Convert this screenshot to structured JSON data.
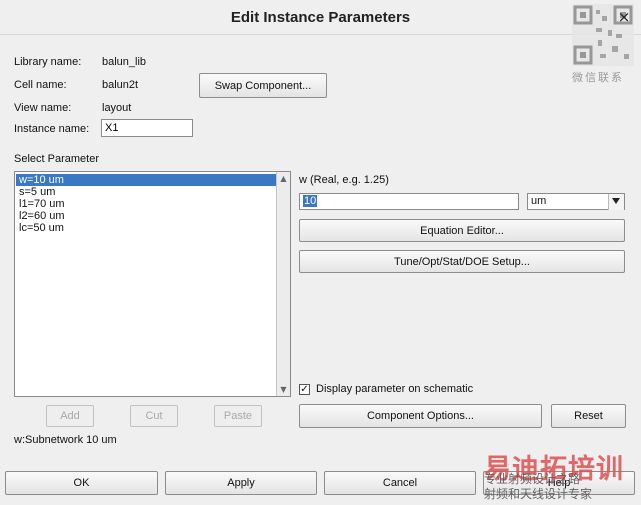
{
  "window": {
    "title": "Edit Instance Parameters",
    "close_glyph": "×"
  },
  "watermark_qr": {
    "caption": "微信联系"
  },
  "info": {
    "library_label": "Library name:",
    "library_value": "balun_lib",
    "cell_label": "Cell name:",
    "cell_value": "balun2t",
    "view_label": "View name:",
    "view_value": "layout",
    "instance_label": "Instance name:",
    "instance_value": "X1"
  },
  "swap_button": "Swap Component...",
  "select_parameter_label": "Select Parameter",
  "parameters": [
    {
      "text": "w=10 um",
      "selected": true
    },
    {
      "text": "s=5 um",
      "selected": false
    },
    {
      "text": "l1=70 um",
      "selected": false
    },
    {
      "text": "l2=60 um",
      "selected": false
    },
    {
      "text": "lc=50 um",
      "selected": false
    }
  ],
  "param_editor": {
    "label": "w (Real, e.g. 1.25)",
    "value": "10",
    "unit": "um",
    "equation_button": "Equation Editor...",
    "tune_button": "Tune/Opt/Stat/DOE Setup..."
  },
  "display_checkbox": {
    "label": "Display parameter on schematic",
    "checked": true,
    "check_glyph": "✓"
  },
  "list_buttons": {
    "add": "Add",
    "cut": "Cut",
    "paste": "Paste"
  },
  "component_options_button": "Component Options...",
  "reset_button": "Reset",
  "status_text": "w:Subnetwork 10 um",
  "footer": {
    "ok": "OK",
    "apply": "Apply",
    "cancel": "Cancel",
    "help": "Help"
  },
  "watermark_brand": {
    "main": "易迪拓培训",
    "sub1": "专业射频设计之路",
    "sub2": "射频和天线设计专家"
  }
}
